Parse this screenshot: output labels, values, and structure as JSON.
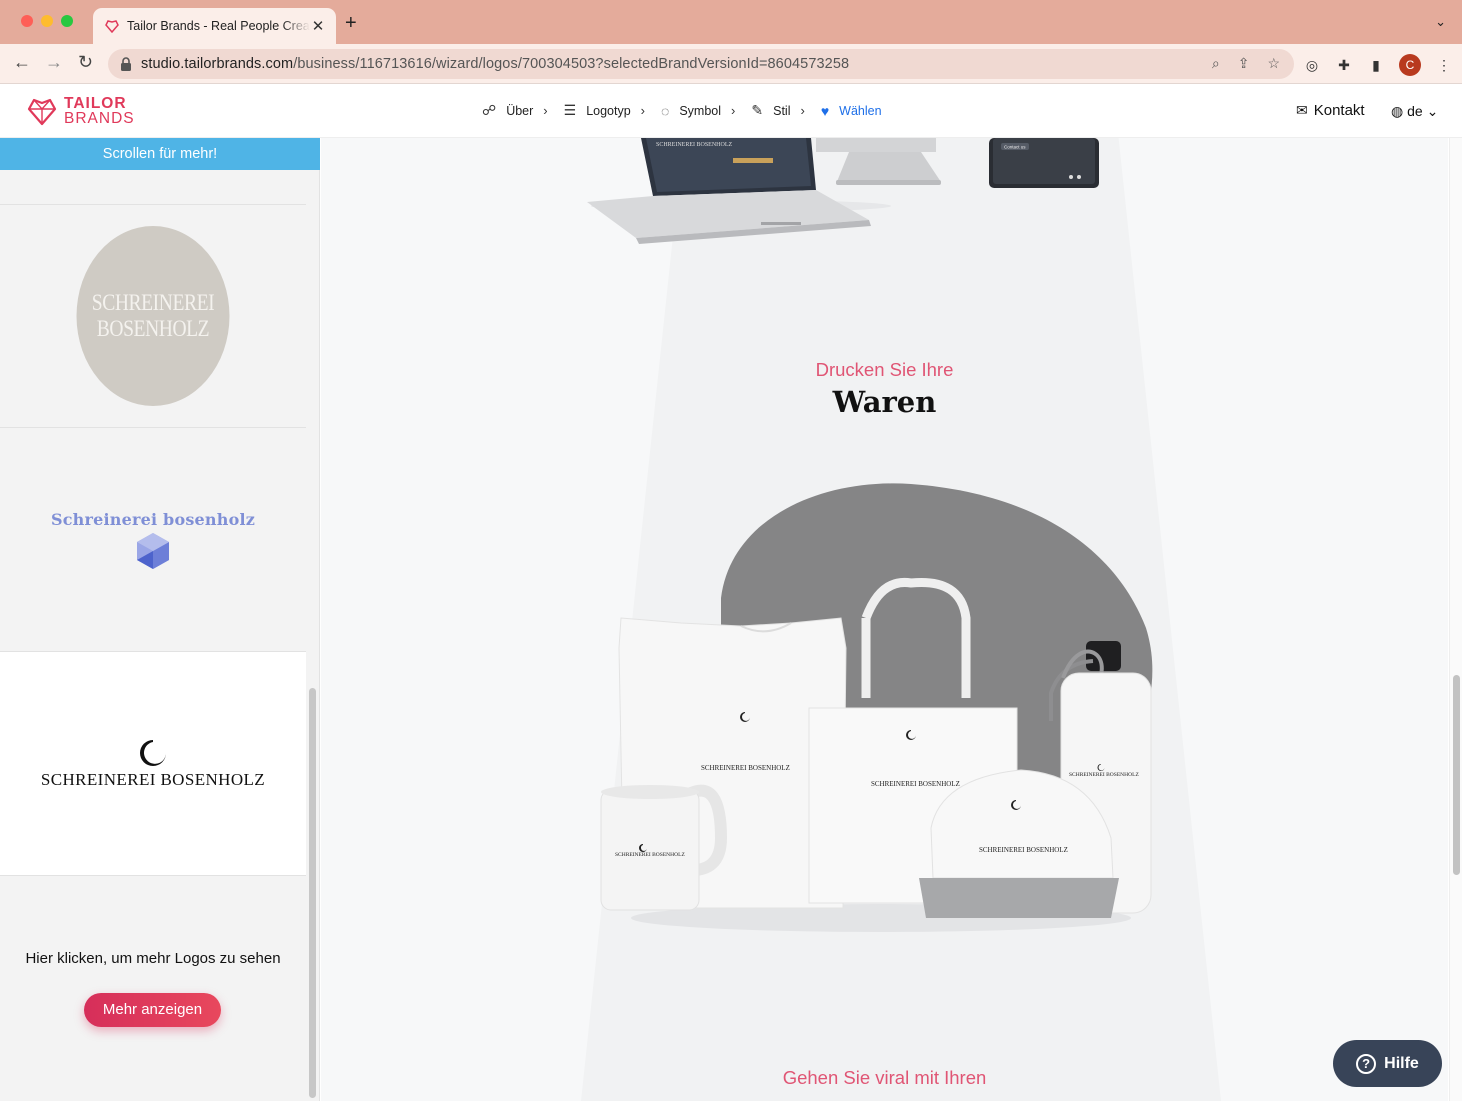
{
  "browser": {
    "tab_title": "Tailor Brands - Real People Create",
    "new_tab_symbol": "+",
    "url_host": "studio.tailorbrands.com",
    "url_path": "/business/116713616/wizard/logos/700304503?selectedBrandVersionId=8604573258",
    "profile_initial": "C"
  },
  "header": {
    "brand_line1": "TAILOR",
    "brand_line2": "BRANDS",
    "steps": [
      {
        "label": "Über",
        "icon": "person-icon"
      },
      {
        "label": "Logotyp",
        "icon": "layers-icon"
      },
      {
        "label": "Symbol",
        "icon": "circle-icon"
      },
      {
        "label": "Stil",
        "icon": "brush-icon"
      },
      {
        "label": "Wählen",
        "icon": "heart-icon"
      }
    ],
    "contact": "Kontakt",
    "language": "de"
  },
  "sidebar": {
    "scroll_banner": "Scrollen für mehr!",
    "logos": [
      {
        "line1": "SCHREINEREI",
        "line2": "BOSENHOLZ"
      },
      {
        "name": "Schreinerei bosenholz"
      },
      {
        "name": "SCHREINEREI BOSENHOLZ"
      }
    ],
    "more_text": "Hier klicken, um mehr Logos zu sehen",
    "more_button": "Mehr anzeigen"
  },
  "main": {
    "laptop_brand": "SCHREINEREI BOSENHOLZ",
    "tablet_button": "Contact us",
    "section1_kicker": "Drucken Sie Ihre",
    "section1_title": "Waren",
    "merch_logo": "SCHREINEREI BOSENHOLZ",
    "section2_kicker": "Gehen Sie viral mit Ihren"
  },
  "help": {
    "label": "Hilfe"
  },
  "colors": {
    "accent": "#e0395a",
    "active_step": "#1e6fe8",
    "banner": "#4fb4e6",
    "kicker": "#e05574"
  }
}
